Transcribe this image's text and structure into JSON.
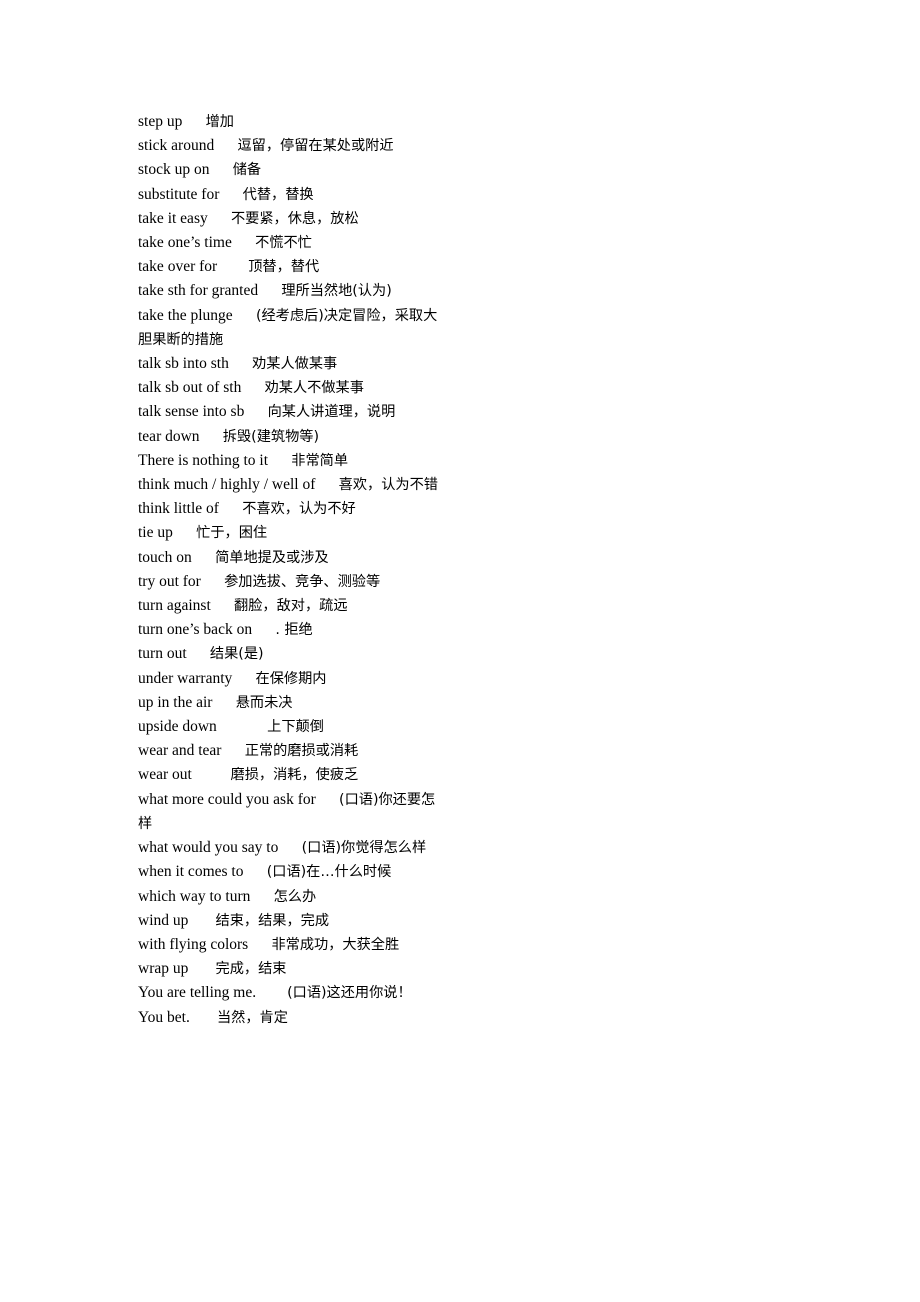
{
  "document": {
    "type": "glossary",
    "language_pair": "English-Chinese",
    "page_background": "#ffffff",
    "text_color": "#000000",
    "entries": [
      {
        "term": "step up",
        "gap": "      ",
        "gloss": "增加"
      },
      {
        "term": "stick around",
        "gap": "      ",
        "gloss": "逗留，停留在某处或附近"
      },
      {
        "term": "stock up on",
        "gap": "      ",
        "gloss": "储备"
      },
      {
        "term": "substitute for",
        "gap": "      ",
        "gloss": "代替，替换"
      },
      {
        "term": "take it easy",
        "gap": "      ",
        "gloss": "不要紧，休息，放松"
      },
      {
        "term": "take one’s time",
        "gap": "      ",
        "gloss": "不慌不忙"
      },
      {
        "term": "take over for",
        "gap": "        ",
        "gloss": "顶替，替代"
      },
      {
        "term": "take sth for granted",
        "gap": "      ",
        "gloss": "理所当然地(认为)"
      },
      {
        "term": "take the plunge",
        "gap": "      ",
        "gloss": "(经考虑后)决定冒险，采取大胆果断的措施"
      },
      {
        "term": "talk sb into sth",
        "gap": "      ",
        "gloss": "劝某人做某事"
      },
      {
        "term": "talk sb out of sth",
        "gap": "      ",
        "gloss": "劝某人不做某事"
      },
      {
        "term": "talk sense into sb",
        "gap": "      ",
        "gloss": "向某人讲道理，说明"
      },
      {
        "term": "tear down",
        "gap": "      ",
        "gloss": "拆毁(建筑物等)"
      },
      {
        "term": "There is nothing to it",
        "gap": "      ",
        "gloss": "非常简单"
      },
      {
        "term": "think much / highly / well of",
        "gap": "      ",
        "gloss": "喜欢，认为不错"
      },
      {
        "term": "think little of",
        "gap": "      ",
        "gloss": "不喜欢，认为不好"
      },
      {
        "term": "tie up",
        "gap": "      ",
        "gloss": "忙于，困住"
      },
      {
        "term": "touch on",
        "gap": "      ",
        "gloss": "简单地提及或涉及"
      },
      {
        "term": "try out for",
        "gap": "      ",
        "gloss": "参加选拔、竞争、测验等"
      },
      {
        "term": "turn against",
        "gap": "      ",
        "gloss": "翻脸，敌对，疏远"
      },
      {
        "term": "turn one’s back on",
        "gap": "      ",
        "gloss": ".  拒绝"
      },
      {
        "term": "turn out",
        "gap": "      ",
        "gloss": "结果(是)"
      },
      {
        "term": "under warranty",
        "gap": "      ",
        "gloss": "在保修期内"
      },
      {
        "term": "up in the air",
        "gap": "      ",
        "gloss": "悬而未决"
      },
      {
        "term": "upside down",
        "gap": "             ",
        "gloss": "上下颠倒"
      },
      {
        "term": "wear and tear",
        "gap": "      ",
        "gloss": "正常的磨损或消耗"
      },
      {
        "term": "wear out",
        "gap": "          ",
        "gloss": "磨损，消耗，使疲乏"
      },
      {
        "term": "what more could you ask for",
        "gap": "      ",
        "gloss": "(口语)你还要怎样"
      },
      {
        "term": "what would you say to",
        "gap": "      ",
        "gloss": "(口语)你觉得怎么样"
      },
      {
        "term": "when it comes to",
        "gap": "      ",
        "gloss": "(口语)在…什么时候"
      },
      {
        "term": "which way to turn",
        "gap": "      ",
        "gloss": "怎么办"
      },
      {
        "term": "wind up",
        "gap": "       ",
        "gloss": "结束，结果，完成"
      },
      {
        "term": "with flying colors",
        "gap": "      ",
        "gloss": "非常成功，大获全胜"
      },
      {
        "term": "wrap up",
        "gap": "       ",
        "gloss": "完成，结束"
      },
      {
        "term": "You are telling me.",
        "gap": "        ",
        "gloss": "(口语)这还用你说！"
      },
      {
        "term": "You bet.",
        "gap": "       ",
        "gloss": "当然，肯定"
      }
    ]
  }
}
